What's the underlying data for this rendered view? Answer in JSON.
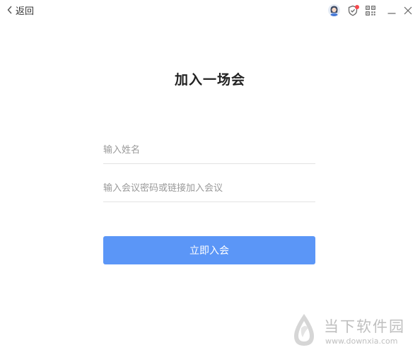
{
  "titlebar": {
    "back_label": "返回",
    "icons": [
      "avatar-icon",
      "shield-notification-icon",
      "qr-code-icon",
      "minimize-icon",
      "close-icon"
    ],
    "notification_color": "#f5484d"
  },
  "main": {
    "title": "加入一场会",
    "name_input": {
      "placeholder": "输入姓名",
      "value": ""
    },
    "meeting_input": {
      "placeholder": "输入会议密码或链接加入会议",
      "value": ""
    },
    "join_button_label": "立即入会",
    "accent_color": "#5b96f7"
  },
  "watermark": {
    "name": "当下软件园",
    "url": "www.downxia.com"
  }
}
